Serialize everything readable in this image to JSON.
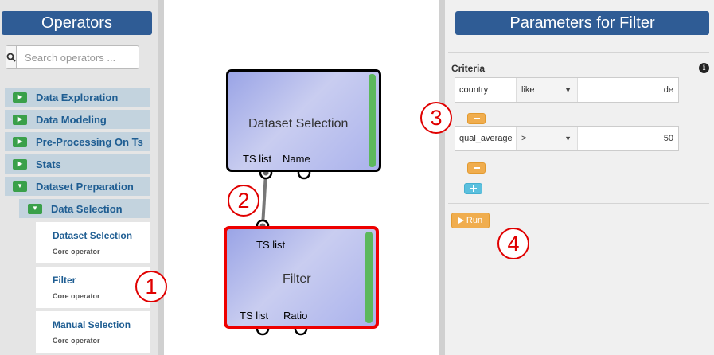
{
  "left_panel": {
    "title": "Operators",
    "search": {
      "placeholder": "Search operators ..."
    },
    "categories": [
      {
        "label": "Data Exploration",
        "expanded": false
      },
      {
        "label": "Data Modeling",
        "expanded": false
      },
      {
        "label": "Pre-Processing On Ts",
        "expanded": false
      },
      {
        "label": "Stats",
        "expanded": false
      },
      {
        "label": "Dataset Preparation",
        "expanded": true
      }
    ],
    "subcategory": {
      "label": "Data Selection",
      "expanded": true
    },
    "operators": [
      {
        "name": "Dataset Selection",
        "sub": "Core operator"
      },
      {
        "name": "Filter",
        "sub": "Core operator"
      },
      {
        "name": "Manual Selection",
        "sub": "Core operator"
      }
    ]
  },
  "canvas": {
    "nodes": {
      "dataset_selection": {
        "title": "Dataset Selection",
        "out_ports": [
          "TS list",
          "Name"
        ]
      },
      "filter": {
        "title": "Filter",
        "in_ports": [
          "TS list"
        ],
        "out_ports": [
          "TS list",
          "Ratio"
        ]
      }
    }
  },
  "right_panel": {
    "title": "Parameters for Filter",
    "criteria_label": "Criteria",
    "criteria": [
      {
        "field": "country",
        "operator": "like",
        "value": "de"
      },
      {
        "field": "qual_average",
        "operator": ">",
        "value": "50"
      }
    ],
    "run_label": "Run"
  },
  "annotations": [
    "1",
    "2",
    "3",
    "4"
  ],
  "colors": {
    "title_bar": "#2f5c95",
    "category_text": "#1e5d92",
    "chevron": "#3aa04a",
    "node_status_bar": "#5cb85c",
    "selected_node_border": "#ee0000",
    "warning_button": "#f0ad4e",
    "info_button": "#5bc0de",
    "annotation": "#e00000"
  },
  "icons": [
    "search-icon",
    "chevron-right-icon",
    "chevron-down-icon",
    "info-icon",
    "minus-icon",
    "plus-icon",
    "play-icon"
  ]
}
